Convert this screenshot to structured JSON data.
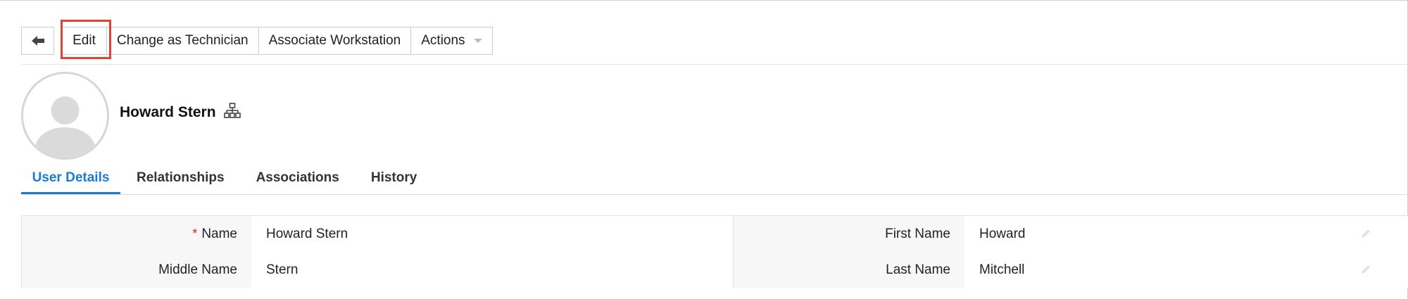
{
  "toolbar": {
    "back_icon": "back-arrow-icon",
    "edit_label": "Edit",
    "change_tech_label": "Change as Technician",
    "associate_label": "Associate Workstation",
    "actions_label": "Actions",
    "highlight_color": "#d9453b"
  },
  "profile": {
    "name": "Howard Stern",
    "avatar_icon": "user-avatar-icon",
    "org_icon": "org-chart-icon"
  },
  "tabs": [
    {
      "label": "User Details",
      "active": true
    },
    {
      "label": "Relationships",
      "active": false
    },
    {
      "label": "Associations",
      "active": false
    },
    {
      "label": "History",
      "active": false
    }
  ],
  "accent_color": "#1a7bd1",
  "details": {
    "rows": [
      {
        "left_label": "Name",
        "left_required": true,
        "left_value": "Howard Stern",
        "right_label": "First Name",
        "right_value": "Howard"
      },
      {
        "left_label": "Middle Name",
        "left_value": "Stern",
        "right_label": "Last Name",
        "right_value": "Mitchell"
      }
    ],
    "required_mark": "*",
    "edit_icon": "pencil-icon"
  }
}
